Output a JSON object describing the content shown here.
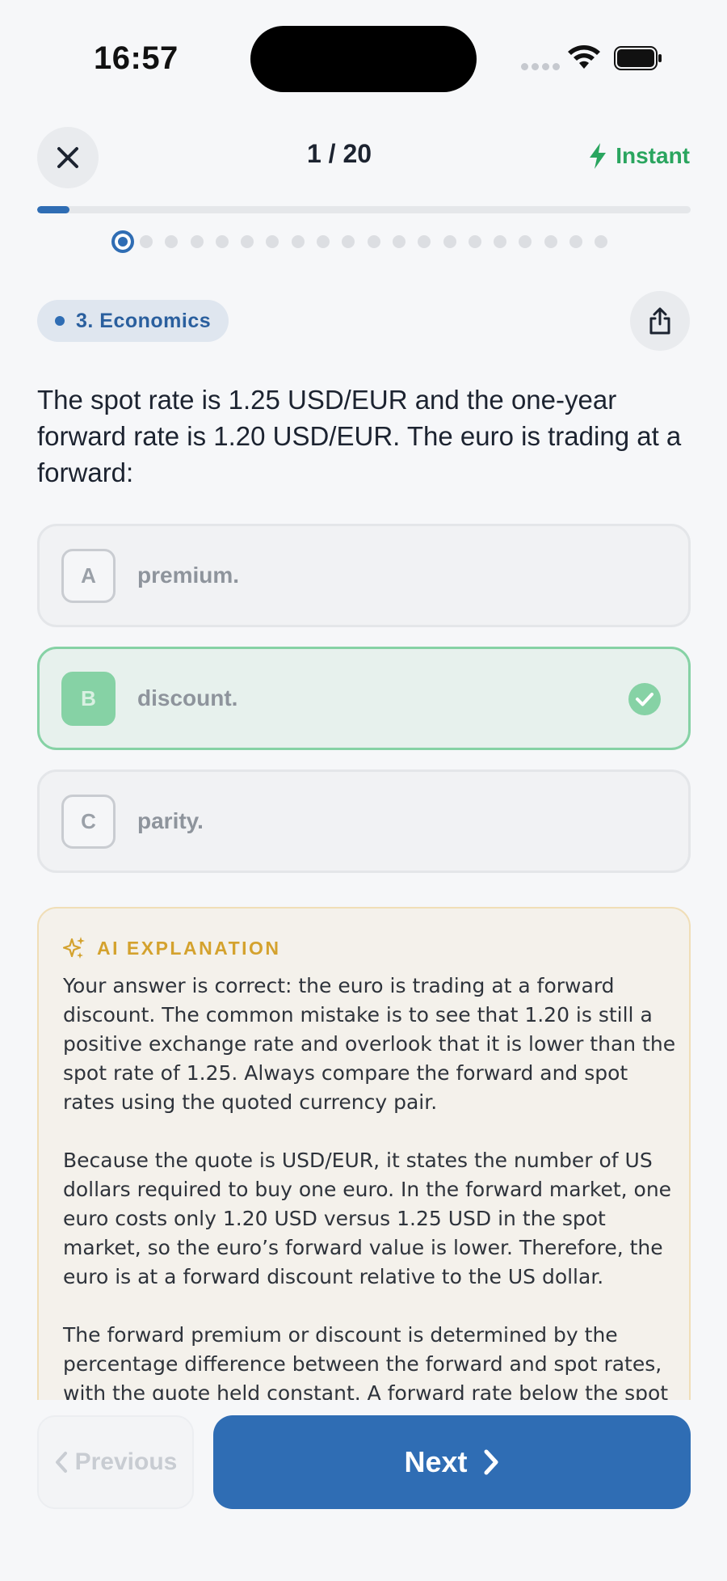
{
  "status_bar": {
    "time": "16:57"
  },
  "header": {
    "progress_counter": "1 / 20",
    "mode_label": "Instant",
    "progress_fraction": 0.05,
    "total_questions": 20,
    "current_question": 1
  },
  "question": {
    "topic": "3. Economics",
    "text": "The spot rate is 1.25 USD/EUR and the one-year forward rate is 1.20 USD/EUR. The euro is trading at a forward:",
    "options": [
      {
        "letter": "A",
        "text": "premium.",
        "state": "neutral"
      },
      {
        "letter": "B",
        "text": "discount.",
        "state": "correct"
      },
      {
        "letter": "C",
        "text": "parity.",
        "state": "neutral"
      }
    ]
  },
  "explanation": {
    "title": "AI EXPLANATION",
    "paragraphs": [
      "Your answer is correct: the euro is trading at a forward discount. The common mistake is to see that 1.20 is still a positive exchange rate and overlook that it is lower than the spot rate of 1.25. Always compare the forward and spot rates using the quoted currency pair.",
      "Because the quote is USD/EUR, it states the number of US dollars required to buy one euro. In the forward market, one euro costs only 1.20 USD versus 1.25 USD in the spot market, so the euro’s forward value is lower. Therefore, the euro is at a forward discount relative to the US dollar.",
      "The forward premium or discount is determined by the percentage difference between the forward and spot rates, with the quote held constant. A forward rate below the spot"
    ]
  },
  "footer": {
    "previous_label": "Previous",
    "next_label": "Next"
  },
  "colors": {
    "primary": "#2f6db4",
    "success": "#2aa55f",
    "accent_gold": "#d4a22e"
  }
}
